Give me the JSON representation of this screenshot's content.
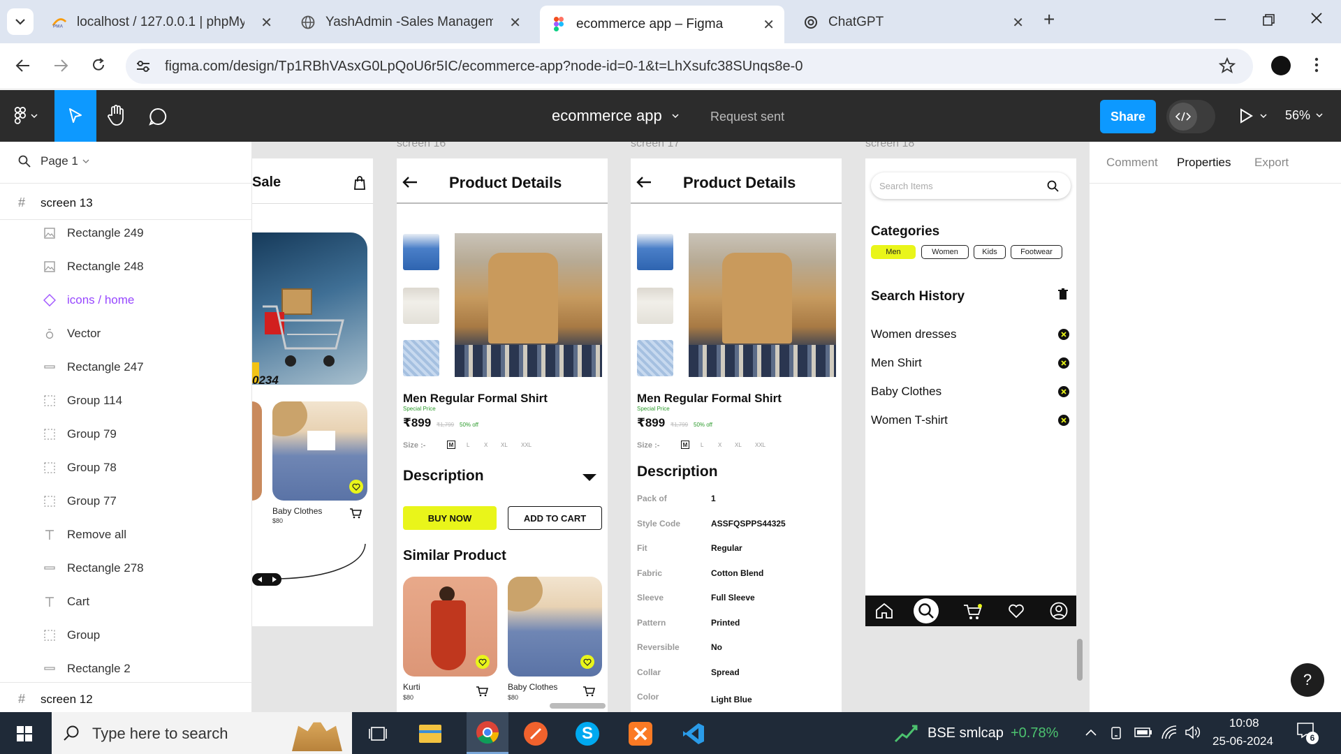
{
  "browser": {
    "tabs": [
      {
        "title": "localhost / 127.0.0.1 | phpMyAdmin",
        "icon": "phpmyadmin-icon"
      },
      {
        "title": "YashAdmin -Sales Management",
        "icon": "globe-icon"
      },
      {
        "title": "ecommerce app – Figma",
        "icon": "figma-icon"
      },
      {
        "title": "ChatGPT",
        "icon": "chatgpt-icon"
      }
    ],
    "url": "figma.com/design/Tp1RBhVAsxG0LpQoU6r5IC/ecommerce-app?node-id=0-1&t=LhXsufc38SUnqs8e-0"
  },
  "figma": {
    "file_name": "ecommerce app",
    "request_status": "Request sent",
    "share_label": "Share",
    "zoom": "56%",
    "page": "Page 1",
    "right_tabs": [
      "Comment",
      "Properties",
      "Export"
    ],
    "help": "?"
  },
  "layers": {
    "screen_top": "screen 13",
    "items": [
      {
        "name": "Rectangle 249",
        "icon": "image-icon"
      },
      {
        "name": "Rectangle 248",
        "icon": "image-icon"
      },
      {
        "name": "icons / home",
        "icon": "component-icon"
      },
      {
        "name": "Vector",
        "icon": "vector-icon"
      },
      {
        "name": "Rectangle 247",
        "icon": "rectangle-icon"
      },
      {
        "name": "Group 114",
        "icon": "group-icon"
      },
      {
        "name": "Group 79",
        "icon": "group-icon"
      },
      {
        "name": "Group 78",
        "icon": "group-icon"
      },
      {
        "name": "Group 77",
        "icon": "group-icon"
      },
      {
        "name": "Remove all",
        "icon": "text-icon"
      },
      {
        "name": "Rectangle 278",
        "icon": "rectangle-icon"
      },
      {
        "name": "Cart",
        "icon": "text-icon"
      },
      {
        "name": "Group",
        "icon": "group-icon"
      },
      {
        "name": "Rectangle 2",
        "icon": "rectangle-icon"
      }
    ],
    "screen_bottom": "screen 12"
  },
  "canvas": {
    "partial": {
      "title": "Sale",
      "code": "0234",
      "product": "Baby Clothes",
      "price": "$80"
    },
    "screen16": {
      "label": "screen 16",
      "header": "Product Details",
      "product_name": "Men Regular Formal Shirt",
      "special": "Special Price",
      "price": "₹899",
      "old_price": "₹1,799",
      "discount": "50% off",
      "size_label": "Size :-",
      "sizes": [
        "M",
        "L",
        "X",
        "XL",
        "XXL"
      ],
      "description": "Description",
      "buy_now": "BUY NOW",
      "add_to_cart": "ADD TO CART",
      "similar": "Similar Product",
      "similar_items": [
        {
          "name": "Kurti",
          "price": "$80"
        },
        {
          "name": "Baby Clothes",
          "price": "$80"
        }
      ]
    },
    "screen17": {
      "label": "screen 17",
      "header": "Product Details",
      "product_name": "Men Regular Formal Shirt",
      "special": "Special Price",
      "price": "₹899",
      "old_price": "₹1,799",
      "discount": "50% off",
      "size_label": "Size :-",
      "sizes": [
        "M",
        "L",
        "X",
        "XL",
        "XXL"
      ],
      "description": "Description",
      "specs": [
        {
          "k": "Pack of",
          "v": "1"
        },
        {
          "k": "Style Code",
          "v": "ASSFQSPPS44325"
        },
        {
          "k": "Fit",
          "v": "Regular"
        },
        {
          "k": "Fabric",
          "v": "Cotton Blend"
        },
        {
          "k": "Sleeve",
          "v": "Full Sleeve"
        },
        {
          "k": "Pattern",
          "v": "Printed"
        },
        {
          "k": "Reversible",
          "v": "No"
        },
        {
          "k": "Collar",
          "v": "Spread"
        },
        {
          "k": "Color",
          "v": "Light Blue"
        }
      ]
    },
    "screen18": {
      "label": "screen 18",
      "search_placeholder": "Search Items",
      "categories_title": "Categories",
      "categories": [
        "Men",
        "Women",
        "Kids",
        "Footwear"
      ],
      "history_title": "Search History",
      "history": [
        "Women dresses",
        "Men Shirt",
        "Baby Clothes",
        "Women T-shirt"
      ]
    }
  },
  "taskbar": {
    "search_placeholder": "Type here to search",
    "stock_name": "BSE smlcap",
    "stock_change": "+0.78%",
    "time": "10:08",
    "date": "25-06-2024",
    "notifications": "6"
  },
  "colors": {
    "accent": "#0d99ff",
    "yellow": "#e9f51a",
    "stock_green": "#4cc26f"
  }
}
